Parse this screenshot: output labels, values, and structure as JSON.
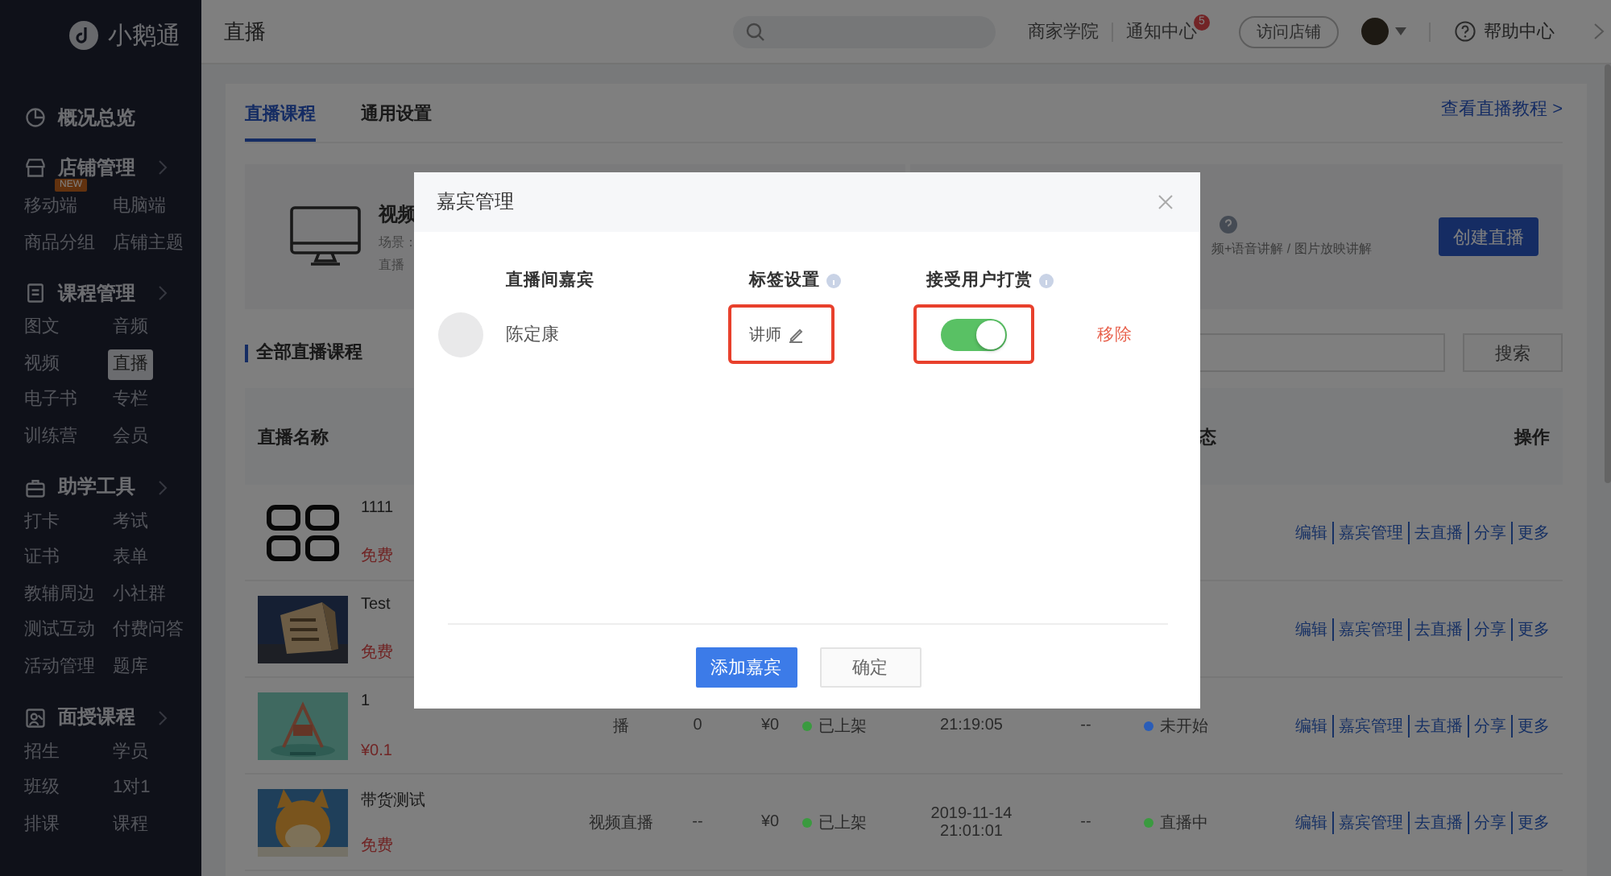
{
  "sidebar": {
    "logo": "小鹅通",
    "sections": [
      {
        "label": "概况总览"
      },
      {
        "label": "店铺管理",
        "children": [
          {
            "label": "移动端",
            "selected": false,
            "badge": "NEW"
          },
          {
            "label": "电脑端",
            "selected": false
          },
          {
            "label": "商品分组",
            "selected": false
          },
          {
            "label": "店铺主题",
            "selected": false
          }
        ]
      },
      {
        "label": "课程管理",
        "children": [
          {
            "label": "图文",
            "selected": false
          },
          {
            "label": "音频",
            "selected": false
          },
          {
            "label": "视频",
            "selected": false
          },
          {
            "label": "直播",
            "selected": true
          },
          {
            "label": "电子书",
            "selected": false
          },
          {
            "label": "专栏",
            "selected": false
          },
          {
            "label": "训练营",
            "selected": false
          },
          {
            "label": "会员",
            "selected": false
          }
        ]
      },
      {
        "label": "助学工具",
        "children": [
          {
            "label": "打卡",
            "selected": false
          },
          {
            "label": "考试",
            "selected": false
          },
          {
            "label": "证书",
            "selected": false
          },
          {
            "label": "表单",
            "selected": false
          },
          {
            "label": "教辅周边",
            "selected": false
          },
          {
            "label": "小社群",
            "selected": false
          },
          {
            "label": "测试互动",
            "selected": false
          },
          {
            "label": "付费问答",
            "selected": false
          },
          {
            "label": "活动管理",
            "selected": false
          },
          {
            "label": "题库",
            "selected": false
          }
        ]
      },
      {
        "label": "面授课程",
        "children": [
          {
            "label": "招生",
            "selected": false
          },
          {
            "label": "学员",
            "selected": false
          },
          {
            "label": "班级",
            "selected": false
          },
          {
            "label": "1对1",
            "selected": false
          },
          {
            "label": "排课",
            "selected": false
          },
          {
            "label": "课程",
            "selected": false
          }
        ]
      }
    ]
  },
  "header": {
    "title": "直播",
    "links": [
      "商家学院",
      "通知中心"
    ],
    "notification_count": "5",
    "visit_button": "访问店铺",
    "help": "帮助中心"
  },
  "tabs": [
    {
      "label": "直播课程",
      "selected": true
    },
    {
      "label": "通用设置",
      "selected": false
    }
  ],
  "tutorial_link": "查看直播教程 >",
  "banner": {
    "left": {
      "title": "视频",
      "lines": [
        "场景：",
        "直播"
      ]
    },
    "right": {
      "subtitle": "频+语音讲解 / 图片放映讲解",
      "button": "创建直播"
    }
  },
  "section_title": "全部直播课程",
  "search_button": "搜索",
  "table": {
    "header": {
      "name": "直播名称",
      "status": "态",
      "actions": "操作"
    },
    "rows": [
      {
        "thumbnail": {
          "kind": "icon"
        },
        "title": "1111",
        "price": "免费",
        "actions": [
          "编辑",
          "嘉宾管理",
          "去直播",
          "分享",
          "更多"
        ]
      },
      {
        "thumbnail": {
          "kind": "picture"
        },
        "title": "Test",
        "price": "免费",
        "actions": [
          "编辑",
          "嘉宾管理",
          "去直播",
          "分享",
          "更多"
        ]
      },
      {
        "thumbnail": {
          "kind": "picture"
        },
        "title": "1",
        "price": "¥0.1",
        "type": "播",
        "count": "0",
        "revenue": "¥0",
        "shelf_status": {
          "label": "已上架",
          "color": "#3a9a3f"
        },
        "time": "21:19:05",
        "column": "--",
        "live_status": {
          "label": "未开始",
          "color": "#2a5db8"
        },
        "actions": [
          "编辑",
          "嘉宾管理",
          "去直播",
          "分享",
          "更多"
        ]
      },
      {
        "thumbnail": {
          "kind": "picture"
        },
        "title": "带货测试",
        "price": "免费",
        "type": "视频直播",
        "count": "--",
        "revenue": "¥0",
        "shelf_status": {
          "label": "已上架",
          "color": "#3a9a3f"
        },
        "time": "2019-11-14 21:01:01",
        "column": "--",
        "live_status": {
          "label": "直播中",
          "color": "#3a9a3f"
        },
        "actions": [
          "编辑",
          "嘉宾管理",
          "去直播",
          "分享",
          "更多"
        ]
      }
    ]
  },
  "modal": {
    "title": "嘉宾管理",
    "columns": [
      "直播间嘉宾",
      "标签设置",
      "接受用户打赏"
    ],
    "guests": [
      {
        "name": "陈定康",
        "tag": "讲师",
        "reward_on": true,
        "remove": "移除"
      }
    ],
    "buttons": [
      {
        "label": "添加嘉宾",
        "kind": "primary"
      },
      {
        "label": "确定",
        "kind": "default"
      }
    ]
  }
}
